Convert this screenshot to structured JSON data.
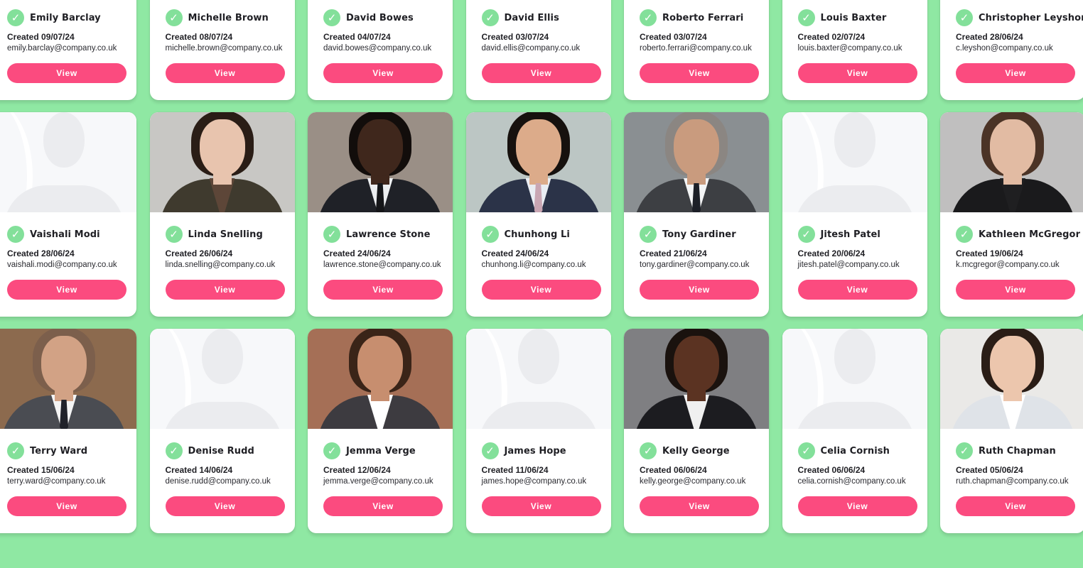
{
  "users": [
    {
      "name": "Emily Barclay",
      "created": "Created 09/07/24",
      "email": "emily.barclay@company.co.uk",
      "button": "View",
      "has_photo": true,
      "bg": "#d9dde2",
      "hair": "#b08a63",
      "skin": "#f1cfb8",
      "suit": "#d4c1a8",
      "shirt": "#f3ece2",
      "tie": ""
    },
    {
      "name": "Michelle Brown",
      "created": "Created 08/07/24",
      "email": "michelle.brown@company.co.uk",
      "button": "View",
      "has_photo": true,
      "bg": "#bfc3c7",
      "hair": "#1e1612",
      "skin": "#6a3f2b",
      "suit": "#3a3d44",
      "shirt": "#e7e6e2",
      "tie": ""
    },
    {
      "name": "David Bowes",
      "created": "Created 04/07/24",
      "email": "david.bowes@company.co.uk",
      "button": "View",
      "has_photo": true,
      "bg": "#4a2f25",
      "hair": "#cfcac2",
      "skin": "#d9ae93",
      "suit": "#6c5a4b",
      "shirt": "#e0d8cb",
      "tie": ""
    },
    {
      "name": "David Ellis",
      "created": "Created 03/07/24",
      "email": "david.ellis@company.co.uk",
      "button": "View",
      "has_photo": true,
      "bg": "#c9cdd0",
      "hair": "#1a1411",
      "skin": "#4b2e20",
      "suit": "#1d2026",
      "shirt": "#eef0f2",
      "tie": "#1a1c22"
    },
    {
      "name": "Roberto Ferrari",
      "created": "Created 03/07/24",
      "email": "roberto.ferrari@company.co.uk",
      "button": "View",
      "has_photo": false
    },
    {
      "name": "Louis Baxter",
      "created": "Created 02/07/24",
      "email": "louis.baxter@company.co.uk",
      "button": "View",
      "has_photo": true,
      "bg": "#cfd9df",
      "hair": "#7a5236",
      "skin": "#f0c6ae",
      "suit": "#f2f4f6",
      "shirt": "#ffffff",
      "tie": "#1d2636"
    },
    {
      "name": "Christopher Leyshon",
      "created": "Created 28/06/24",
      "email": "c.leyshon@company.co.uk",
      "button": "View",
      "has_photo": true,
      "bg": "#5a4a40",
      "hair": "#15100d",
      "skin": "#4a2c1f",
      "suit": "#1c1f26",
      "shirt": "#f1f1f1",
      "tie": "#111318"
    },
    {
      "name": "Vaishali Modi",
      "created": "Created 28/06/24",
      "email": "vaishali.modi@company.co.uk",
      "button": "View",
      "has_photo": false
    },
    {
      "name": "Linda Snelling",
      "created": "Created 26/06/24",
      "email": "linda.snelling@company.co.uk",
      "button": "View",
      "has_photo": true,
      "bg": "#c8c7c4",
      "hair": "#2a1d16",
      "skin": "#e8c4ae",
      "suit": "#3f3a2e",
      "shirt": "#5d4638",
      "tie": ""
    },
    {
      "name": "Lawrence Stone",
      "created": "Created 24/06/24",
      "email": "lawrence.stone@company.co.uk",
      "button": "View",
      "has_photo": true,
      "bg": "#9a8f86",
      "hair": "#120d0b",
      "skin": "#3f271c",
      "suit": "#1f2127",
      "shirt": "#eceef0",
      "tie": "#151619"
    },
    {
      "name": "Chunhong Li",
      "created": "Created 24/06/24",
      "email": "chunhong.li@company.co.uk",
      "button": "View",
      "has_photo": true,
      "bg": "#bcc6c4",
      "hair": "#16110e",
      "skin": "#dcab8a",
      "suit": "#2b3348",
      "shirt": "#e9edf3",
      "tie": "#c9a6b3"
    },
    {
      "name": "Tony Gardiner",
      "created": "Created 21/06/24",
      "email": "tony.gardiner@company.co.uk",
      "button": "View",
      "has_photo": true,
      "bg": "#8a8f92",
      "hair": "#8b8682",
      "skin": "#c99b7e",
      "suit": "#3d3f43",
      "shirt": "#f3f4f5",
      "tie": "#1c1f27"
    },
    {
      "name": "Jitesh Patel",
      "created": "Created 20/06/24",
      "email": "jitesh.patel@company.co.uk",
      "button": "View",
      "has_photo": false
    },
    {
      "name": "Kathleen McGregor",
      "created": "Created 19/06/24",
      "email": "k.mcgregor@company.co.uk",
      "button": "View",
      "has_photo": true,
      "bg": "#c0bfbf",
      "hair": "#4b3326",
      "skin": "#e2bba3",
      "suit": "#1a1a1c",
      "shirt": "#1f1f21",
      "tie": ""
    },
    {
      "name": "Terry Ward",
      "created": "Created 15/06/24",
      "email": "terry.ward@company.co.uk",
      "button": "View",
      "has_photo": true,
      "bg": "#8c6a4e",
      "hair": "#7c5f4c",
      "skin": "#d2a285",
      "suit": "#4a4c52",
      "shirt": "#f4f4f4",
      "tie": "#20222a"
    },
    {
      "name": "Denise Rudd",
      "created": "Created 14/06/24",
      "email": "denise.rudd@company.co.uk",
      "button": "View",
      "has_photo": false
    },
    {
      "name": "Jemma Verge",
      "created": "Created 12/06/24",
      "email": "jemma.verge@company.co.uk",
      "button": "View",
      "has_photo": true,
      "bg": "#a56f56",
      "hair": "#3a2418",
      "skin": "#c78e6f",
      "suit": "#3d3b40",
      "shirt": "#ffffff",
      "tie": ""
    },
    {
      "name": "James Hope",
      "created": "Created 11/06/24",
      "email": "james.hope@company.co.uk",
      "button": "View",
      "has_photo": false
    },
    {
      "name": "Kelly George",
      "created": "Created 06/06/24",
      "email": "kelly.george@company.co.uk",
      "button": "View",
      "has_photo": true,
      "bg": "#7f7f82",
      "hair": "#1a120e",
      "skin": "#5b3322",
      "suit": "#1c1c20",
      "shirt": "#f0f0f0",
      "tie": ""
    },
    {
      "name": "Celia Cornish",
      "created": "Created 06/06/24",
      "email": "celia.cornish@company.co.uk",
      "button": "View",
      "has_photo": false
    },
    {
      "name": "Ruth Chapman",
      "created": "Created 05/06/24",
      "email": "ruth.chapman@company.co.uk",
      "button": "View",
      "has_photo": true,
      "bg": "#eae9e7",
      "hair": "#2a1d16",
      "skin": "#ecc6ad",
      "suit": "#dfe3e8",
      "shirt": "#ffffff",
      "tie": ""
    }
  ],
  "colors": {
    "background": "#8fe8a3",
    "button": "#fb4b7f",
    "check": "#83e09a"
  },
  "icons": {
    "verified": "check-circle-icon",
    "placeholder": "user-silhouette-icon"
  }
}
